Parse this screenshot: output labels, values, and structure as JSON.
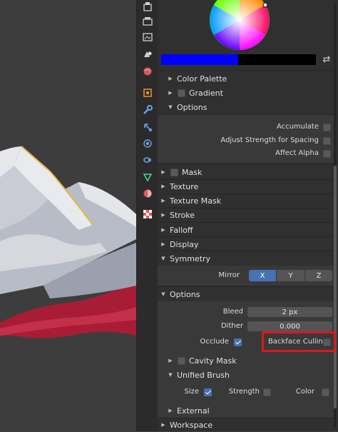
{
  "colors": {
    "accent": "#4772b3",
    "primary_color": "#0000ff",
    "secondary_color": "#000000",
    "highlight": "#e0151f"
  },
  "tabs": [
    {
      "icon": "tool-icon",
      "label": ""
    },
    {
      "icon": "render-icon",
      "label": ""
    },
    {
      "icon": "output-icon",
      "label": ""
    },
    {
      "icon": "view-layer-icon",
      "label": ""
    },
    {
      "icon": "world-icon",
      "label": ""
    },
    {
      "icon": "object-icon",
      "label": ""
    },
    {
      "icon": "modifier-icon",
      "label": ""
    },
    {
      "icon": "particles-icon",
      "label": ""
    },
    {
      "icon": "physics-icon",
      "label": ""
    },
    {
      "icon": "constraints-icon",
      "label": ""
    },
    {
      "icon": "data-icon",
      "label": ""
    },
    {
      "icon": "material-icon",
      "label": ""
    },
    {
      "icon": "texture-icon",
      "label": ""
    }
  ],
  "panel": {
    "color_palette": "Color Palette",
    "gradient": "Gradient",
    "options_sub": "Options",
    "accumulate": "Accumulate",
    "adjust_strength": "Adjust Strength for Spacing",
    "affect_alpha": "Affect Alpha",
    "mask": "Mask",
    "texture": "Texture",
    "texture_mask": "Texture Mask",
    "stroke": "Stroke",
    "falloff": "Falloff",
    "display": "Display",
    "symmetry": "Symmetry",
    "mirror_label": "Mirror",
    "mirror_axes": [
      "X",
      "Y",
      "Z"
    ],
    "options": "Options",
    "bleed_label": "Bleed",
    "bleed_value": "2 px",
    "dither_label": "Dither",
    "dither_value": "0.000",
    "occlude_label": "Occlude",
    "backface_culling": "Backface Culling",
    "cavity_mask": "Cavity Mask",
    "unified_brush": "Unified Brush",
    "size": "Size",
    "strength": "Strength",
    "color": "Color",
    "external": "External",
    "workspace": "Workspace"
  },
  "state": {
    "accumulate": false,
    "adjust_strength": false,
    "affect_alpha": false,
    "mask": false,
    "gradient": false,
    "mirror_active": "X",
    "occlude": true,
    "backface_culling": false,
    "cavity_mask": false,
    "unified_size": true,
    "unified_strength": false,
    "unified_color": false
  }
}
